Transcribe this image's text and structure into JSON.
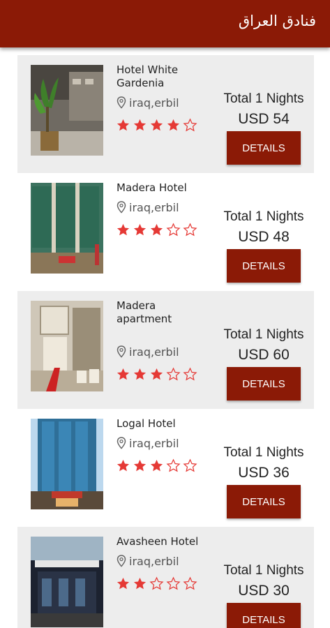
{
  "app_bar": {
    "title": "فنادق العراق"
  },
  "theme": {
    "primary": "#8b1a06",
    "star_color": "#e53935",
    "card_alt_bg": "#ededed"
  },
  "hotels": [
    {
      "name": "Hotel White Gardenia",
      "location": "iraq,erbil",
      "rating": 4,
      "max_rating": 5,
      "total_label": "Total 1 Nights",
      "price": "USD 54",
      "button_label": "DETAILS",
      "image": "hotel-lobby-with-plant"
    },
    {
      "name": "Madera Hotel",
      "location": "iraq,erbil",
      "rating": 3,
      "max_rating": 5,
      "total_label": "Total 1 Nights",
      "price": "USD 48",
      "button_label": "DETAILS",
      "image": "hotel-building-facade"
    },
    {
      "name": "Madera apartment",
      "location": "iraq,erbil",
      "rating": 3,
      "max_rating": 5,
      "total_label": "Total 1 Nights",
      "price": "USD 60",
      "button_label": "DETAILS",
      "image": "apartment-lobby"
    },
    {
      "name": "Logal Hotel",
      "location": "iraq,erbil",
      "rating": 3,
      "max_rating": 5,
      "total_label": "Total 1 Nights",
      "price": "USD 36",
      "button_label": "DETAILS",
      "image": "hotel-glass-tower"
    },
    {
      "name": "Avasheen Hotel",
      "location": "iraq,erbil",
      "rating": 2,
      "max_rating": 5,
      "total_label": "Total 1 Nights",
      "price": "USD 30",
      "button_label": "DETAILS",
      "image": "hotel-entrance-night"
    }
  ]
}
